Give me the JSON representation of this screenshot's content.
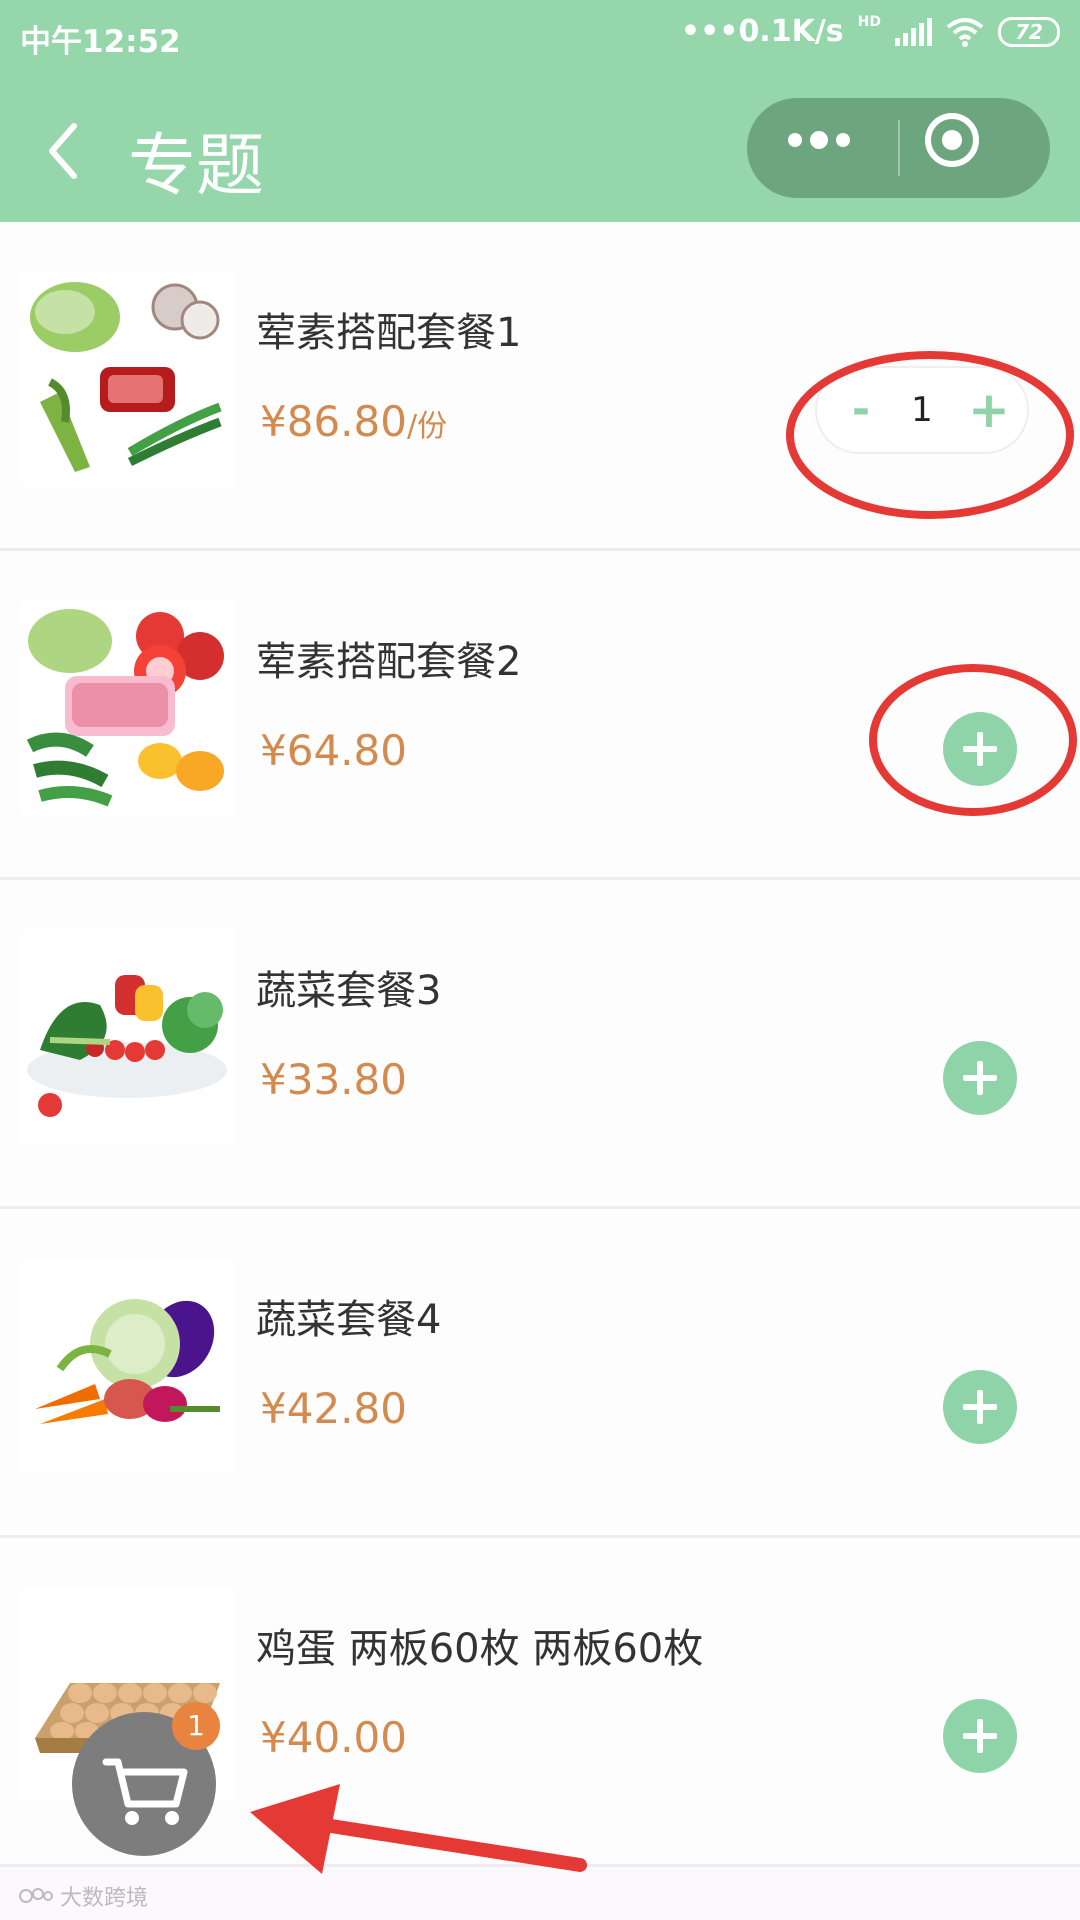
{
  "status_bar": {
    "time": "中午12:52",
    "network_speed": "0.1K/s",
    "network_type": "HD",
    "battery": "72"
  },
  "nav": {
    "title": "专题",
    "back_icon": "chevron-left-icon",
    "more_icon": "more-dots-icon",
    "close_icon": "target-close-icon"
  },
  "products": [
    {
      "name": "荤素搭配套餐1",
      "price": "¥86.80",
      "unit": "/份",
      "quantity": "1",
      "thumb_icon": "vegetables-meat-icon"
    },
    {
      "name": "荤素搭配套餐2",
      "price": "¥64.80",
      "unit": "",
      "thumb_icon": "tomato-meat-pepper-icon"
    },
    {
      "name": "蔬菜套餐3",
      "price": "¥33.80",
      "unit": "",
      "thumb_icon": "vegetable-plate-icon"
    },
    {
      "name": "蔬菜套餐4",
      "price": "¥42.80",
      "unit": "",
      "thumb_icon": "cabbage-vegetables-icon"
    },
    {
      "name": "鸡蛋 两板60枚 两板60枚",
      "price": "¥40.00",
      "unit": "",
      "thumb_icon": "egg-tray-icon"
    }
  ],
  "stepper": {
    "minus": "-",
    "plus": "+"
  },
  "cart": {
    "badge_count": "1",
    "icon": "shopping-cart-icon"
  },
  "watermark": "大数跨境",
  "colors": {
    "theme_green": "#95d6ab",
    "button_green": "#8ed4a8",
    "price_orange": "#d28a4e",
    "badge_orange": "#e98440",
    "annotation_red": "#e53935"
  }
}
